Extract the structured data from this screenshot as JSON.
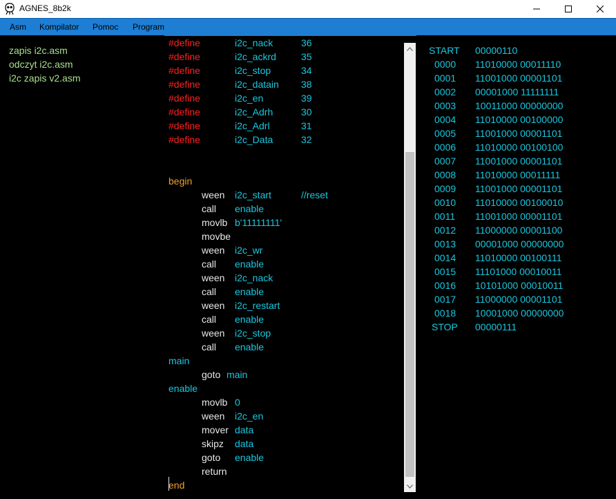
{
  "window": {
    "title": "AGNES_8b2k"
  },
  "menu": [
    "Asm",
    "Kompilator",
    "Pomoc",
    "Program"
  ],
  "files": [
    "zapis i2c.asm",
    "odczyt i2c.asm",
    "i2c zapis v2.asm"
  ],
  "defines": [
    {
      "kw": "#define",
      "name": "i2c_nack",
      "val": "36"
    },
    {
      "kw": "#define",
      "name": "i2c_ackrd",
      "val": "35"
    },
    {
      "kw": "#define",
      "name": "i2c_stop",
      "val": "34"
    },
    {
      "kw": "#define",
      "name": "i2c_datain",
      "val": "38"
    },
    {
      "kw": "#define",
      "name": "i2c_en",
      "val": "39"
    },
    {
      "kw": "#define",
      "name": "i2c_Adrh",
      "val": "30"
    },
    {
      "kw": "#define",
      "name": "i2c_Adrl",
      "val": "31"
    },
    {
      "kw": "#define",
      "name": "i2c_Data",
      "val": "32"
    }
  ],
  "code": {
    "begin_label": "begin",
    "begin_body": [
      {
        "op": "ween",
        "arg": "i2c_start",
        "comment": "//reset"
      },
      {
        "op": "call",
        "arg": "enable",
        "comment": ""
      },
      {
        "op": "movlb",
        "arg": "b'11111111'",
        "comment": ""
      },
      {
        "op": "movbe",
        "arg": "",
        "comment": ""
      },
      {
        "op": "ween",
        "arg": "i2c_wr",
        "comment": ""
      },
      {
        "op": "call",
        "arg": "enable",
        "comment": ""
      },
      {
        "op": "ween",
        "arg": "i2c_nack",
        "comment": ""
      },
      {
        "op": "call",
        "arg": "enable",
        "comment": ""
      },
      {
        "op": "ween",
        "arg": "i2c_restart",
        "comment": ""
      },
      {
        "op": "call",
        "arg": "enable",
        "comment": ""
      },
      {
        "op": "ween",
        "arg": "i2c_stop",
        "comment": ""
      },
      {
        "op": "call",
        "arg": "enable",
        "comment": ""
      }
    ],
    "main_label": "main",
    "main_body": [
      {
        "op": "goto",
        "arg": "main"
      }
    ],
    "enable_label": "enable",
    "enable_body": [
      {
        "op": "movlb",
        "arg": "0"
      },
      {
        "op": "ween",
        "arg": "i2c_en"
      },
      {
        "op": "mover",
        "arg": "data"
      },
      {
        "op": "skipz",
        "arg": "data"
      },
      {
        "op": "goto",
        "arg": "enable"
      },
      {
        "op": "return",
        "arg": ""
      }
    ],
    "end_label": "end"
  },
  "output": [
    {
      "addr": "START",
      "bits": "00000110"
    },
    {
      "addr": "0000",
      "bits": "11010000 00011110"
    },
    {
      "addr": "0001",
      "bits": "11001000 00001101"
    },
    {
      "addr": "0002",
      "bits": "00001000 11111111"
    },
    {
      "addr": "0003",
      "bits": "10011000 00000000"
    },
    {
      "addr": "0004",
      "bits": "11010000 00100000"
    },
    {
      "addr": "0005",
      "bits": "11001000 00001101"
    },
    {
      "addr": "0006",
      "bits": "11010000 00100100"
    },
    {
      "addr": "0007",
      "bits": "11001000 00001101"
    },
    {
      "addr": "0008",
      "bits": "11010000 00011111"
    },
    {
      "addr": "0009",
      "bits": "11001000 00001101"
    },
    {
      "addr": "0010",
      "bits": "11010000 00100010"
    },
    {
      "addr": "0011",
      "bits": "11001000 00001101"
    },
    {
      "addr": "0012",
      "bits": "11000000 00001100"
    },
    {
      "addr": "0013",
      "bits": "00001000 00000000"
    },
    {
      "addr": "0014",
      "bits": "11010000 00100111"
    },
    {
      "addr": "0015",
      "bits": "11101000 00010011"
    },
    {
      "addr": "0016",
      "bits": "10101000 00010011"
    },
    {
      "addr": "0017",
      "bits": "11000000 00001101"
    },
    {
      "addr": "0018",
      "bits": "10001000 00000000"
    },
    {
      "addr": "STOP",
      "bits": "00000111"
    }
  ],
  "colors": {
    "menubar": "#1e7ed4",
    "define": "#ff2020",
    "symbol": "#19c8e0",
    "file": "#a8e08c",
    "begin_end": "#f0a030"
  }
}
